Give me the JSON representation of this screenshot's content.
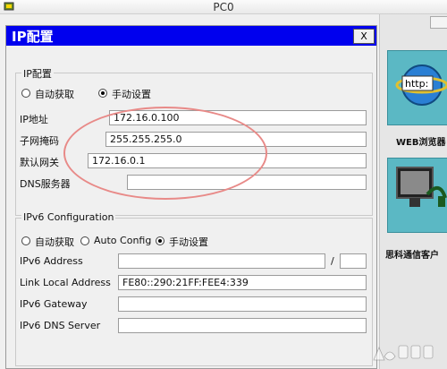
{
  "window": {
    "title": "PC0",
    "icon": "app-icon"
  },
  "dialog": {
    "title": "IP配置",
    "close_label": "X"
  },
  "ipv4": {
    "group_title": "IP配置",
    "radio_auto": "自动获取",
    "radio_manual": "手动设置",
    "selected": "manual",
    "ip_label": "IP地址",
    "ip_value": "172.16.0.100",
    "mask_label": "子网掩码",
    "mask_value": "255.255.255.0",
    "gateway_label": "默认网关",
    "gateway_value": "172.16.0.1",
    "dns_label": "DNS服务器",
    "dns_value": ""
  },
  "ipv6": {
    "group_title": "IPv6 Configuration",
    "radio_auto": "自动获取",
    "radio_autoconfig": "Auto Config",
    "radio_manual": "手动设置",
    "selected": "manual",
    "address_label": "IPv6 Address",
    "address_value": "",
    "prefix_separator": "/",
    "prefix_value": "",
    "link_local_label": "Link Local Address",
    "link_local_value": "FE80::290:21FF:FEE4:339",
    "gateway_label": "IPv6 Gateway",
    "gateway_value": "",
    "dns_label": "IPv6 DNS Server",
    "dns_value": ""
  },
  "desktop": {
    "web_browser_label": "WEB浏览器",
    "web_browser_icon": "browser-icon",
    "browser_icon_text": "http:",
    "client_label": "思科通信客户",
    "client_icon": "communicator-icon"
  },
  "colors": {
    "dialog_title_bg": "#0000ee",
    "annotation": "#e88a88",
    "tile_bg": "#5bb8c4"
  }
}
